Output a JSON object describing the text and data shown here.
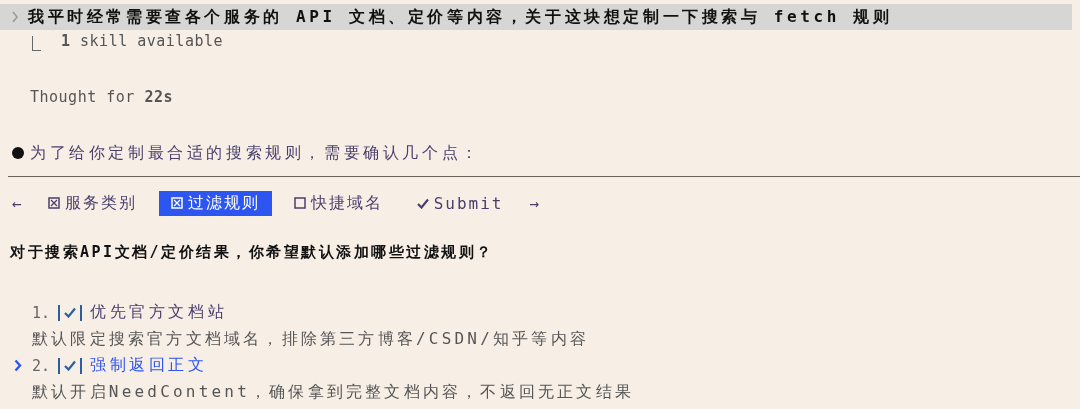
{
  "prompt": {
    "text": "我平时经常需要查各个服务的 API 文档、定价等内容，关于这块想定制一下搜索与 fetch 规则"
  },
  "skill_note": "**1** skill available",
  "thought": "Thought for **22s**",
  "message": "为了给你定制最合适的搜索规则，需要确认几个点：",
  "tabs": [
    {
      "kind": "prev",
      "label": "←"
    },
    {
      "kind": "step",
      "label": "服务类别",
      "checked": true,
      "selected": false
    },
    {
      "kind": "step",
      "label": "过滤规则",
      "checked": true,
      "selected": true
    },
    {
      "kind": "step",
      "label": "快捷域名",
      "checked": false,
      "selected": false
    },
    {
      "kind": "submit",
      "label": "Submit",
      "selected": false
    },
    {
      "kind": "next",
      "label": "→"
    }
  ],
  "question": "对于搜索API文档/定价结果，你希望默认添加哪些过滤规则？",
  "options": [
    {
      "number": "1.",
      "checked": true,
      "label": "优先官方文档站",
      "description": "默认限定搜索官方文档域名，排除第三方博客/CSDN/知乎等内容",
      "selected": false
    },
    {
      "number": "2.",
      "checked": true,
      "label": "强制返回正文",
      "description": "默认开启NeedContent，确保拿到完整文档内容，不返回无正文结果",
      "selected": true
    }
  ]
}
